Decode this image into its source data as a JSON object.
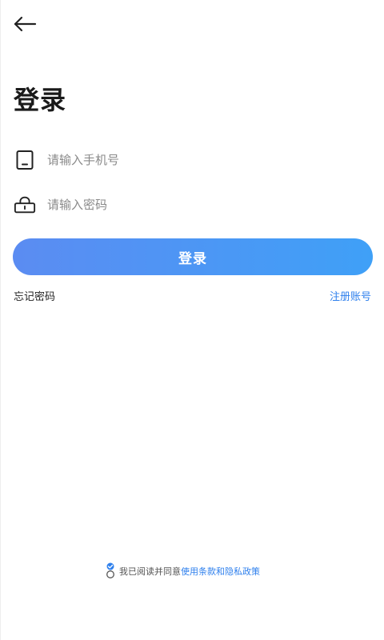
{
  "header": {
    "back_icon": "arrow-left-icon"
  },
  "title": "登录",
  "phone_field": {
    "icon": "phone-icon",
    "placeholder": "请输入手机号",
    "value": ""
  },
  "password_field": {
    "icon": "lock-icon",
    "placeholder": "请输入密码",
    "value": ""
  },
  "login_button": {
    "label": "登录"
  },
  "links": {
    "forgot_password": "忘记密码",
    "register": "注册账号"
  },
  "agreement": {
    "checked": true,
    "prefix": "我已阅读并同意",
    "policy_link": "使用条款和隐私政策"
  },
  "colors": {
    "accent": "#2f80ed",
    "button_start": "#5b8cf2",
    "button_end": "#3fa0f7"
  }
}
